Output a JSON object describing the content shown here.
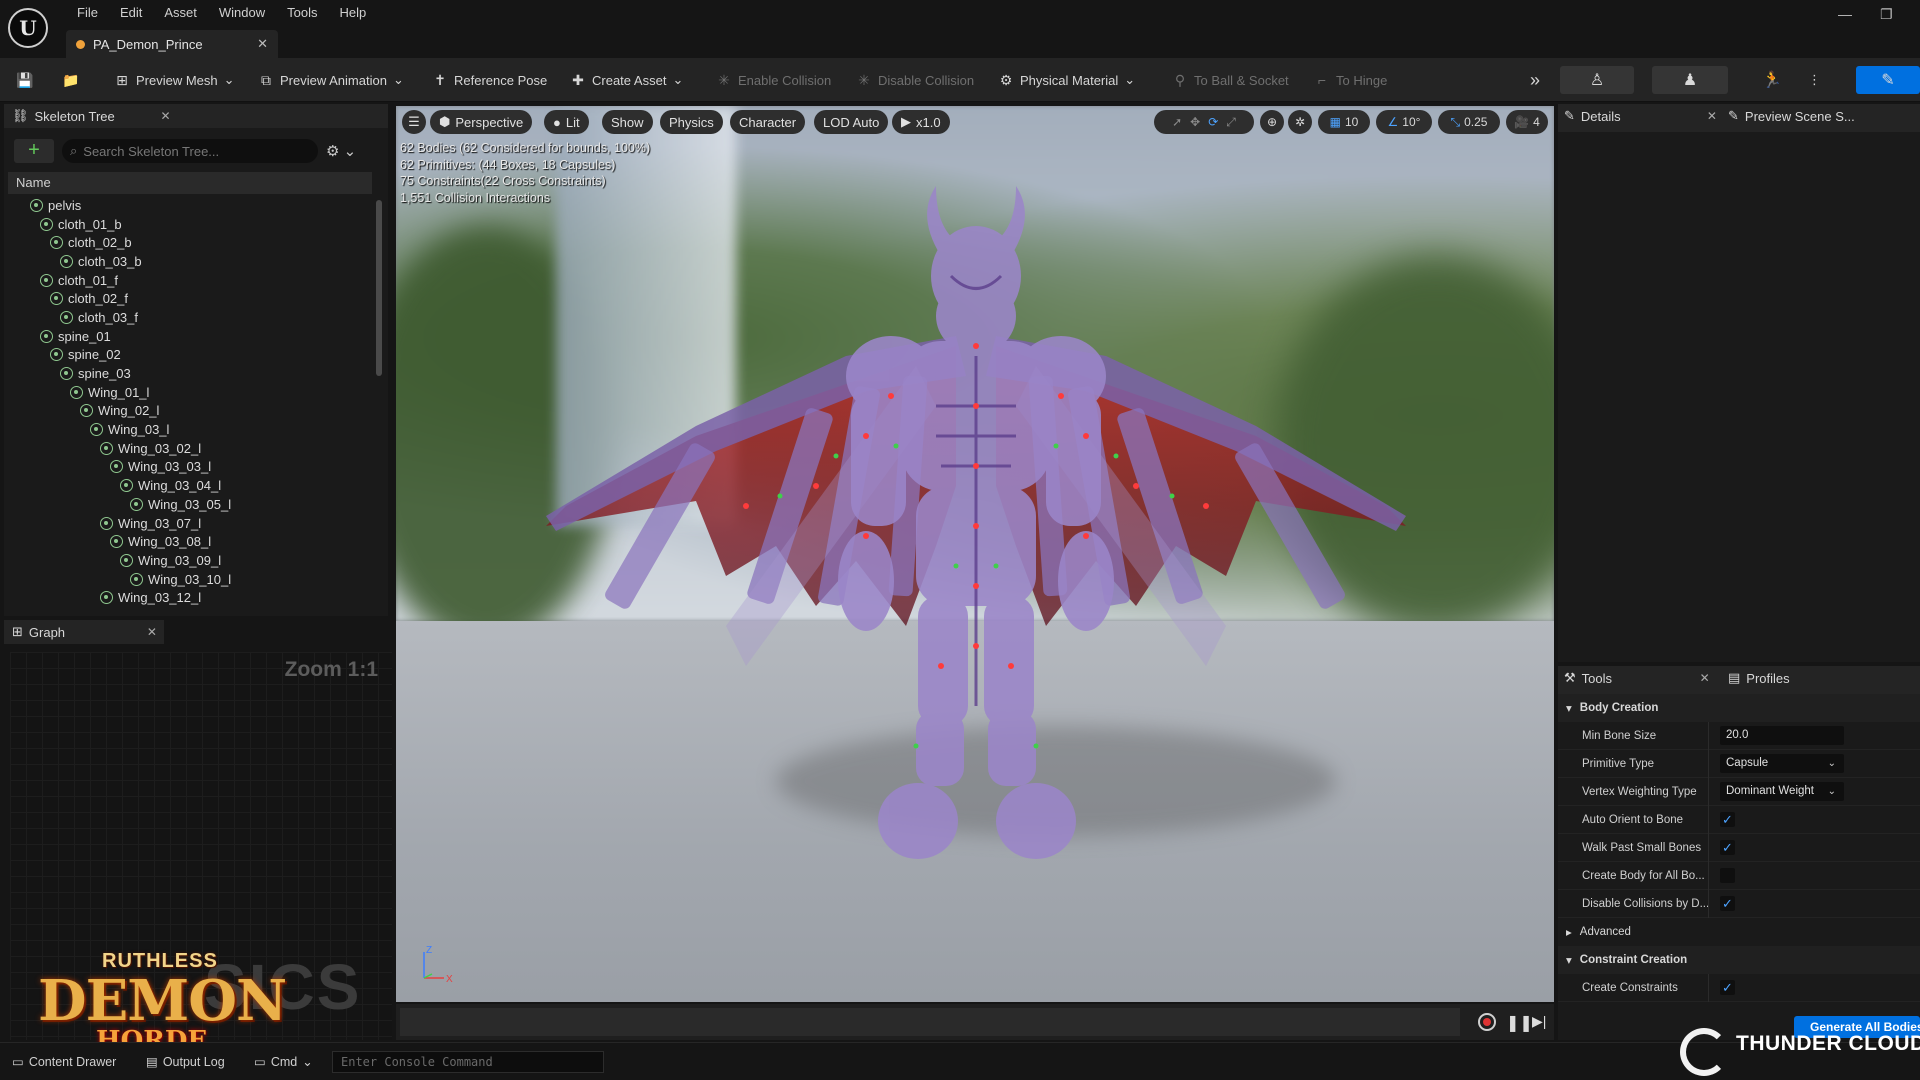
{
  "app": {
    "menu": [
      "File",
      "Edit",
      "Asset",
      "Window",
      "Tools",
      "Help"
    ],
    "tab_title": "PA_Demon_Prince"
  },
  "toolbar": {
    "preview_mesh": "Preview Mesh",
    "preview_animation": "Preview Animation",
    "reference_pose": "Reference Pose",
    "create_asset": "Create Asset",
    "enable_collision": "Enable Collision",
    "disable_collision": "Disable Collision",
    "physical_material": "Physical Material",
    "to_ball_socket": "To Ball & Socket",
    "to_hinge": "To Hinge"
  },
  "skeleton_tree": {
    "title": "Skeleton Tree",
    "search_placeholder": "Search Skeleton Tree...",
    "column_name": "Name",
    "bones": [
      {
        "name": "pelvis",
        "depth": 1
      },
      {
        "name": "cloth_01_b",
        "depth": 2
      },
      {
        "name": "cloth_02_b",
        "depth": 3
      },
      {
        "name": "cloth_03_b",
        "depth": 4
      },
      {
        "name": "cloth_01_f",
        "depth": 2
      },
      {
        "name": "cloth_02_f",
        "depth": 3
      },
      {
        "name": "cloth_03_f",
        "depth": 4
      },
      {
        "name": "spine_01",
        "depth": 2
      },
      {
        "name": "spine_02",
        "depth": 3
      },
      {
        "name": "spine_03",
        "depth": 4
      },
      {
        "name": "Wing_01_l",
        "depth": 5
      },
      {
        "name": "Wing_02_l",
        "depth": 6
      },
      {
        "name": "Wing_03_l",
        "depth": 7
      },
      {
        "name": "Wing_03_02_l",
        "depth": 8
      },
      {
        "name": "Wing_03_03_l",
        "depth": 9
      },
      {
        "name": "Wing_03_04_l",
        "depth": 10
      },
      {
        "name": "Wing_03_05_l",
        "depth": 11
      },
      {
        "name": "Wing_03_07_l",
        "depth": 8
      },
      {
        "name": "Wing_03_08_l",
        "depth": 9
      },
      {
        "name": "Wing_03_09_l",
        "depth": 10
      },
      {
        "name": "Wing_03_10_l",
        "depth": 11
      },
      {
        "name": "Wing_03_12_l",
        "depth": 8
      }
    ]
  },
  "graph": {
    "title": "Graph",
    "zoom": "Zoom 1:1",
    "watermark": "SICS"
  },
  "demon_logo": {
    "line1": "RUTHLESS",
    "line2": "DEMON",
    "line3": "HORDE"
  },
  "viewport": {
    "perspective": "Perspective",
    "lit": "Lit",
    "show": "Show",
    "physics": "Physics",
    "character": "Character",
    "lod": "LOD Auto",
    "speed": "x1.0",
    "grid_snap": "10",
    "rot_snap": "10°",
    "scale_snap": "0.25",
    "camera_speed": "4",
    "stats": [
      "62 Bodies (62 Considered for bounds, 100%)",
      "62 Primitives: (44 Boxes, 18 Capsules)",
      "75 Constraints(22 Cross Constraints)",
      "1,551 Collision Interactions"
    ],
    "axis_z": "Z",
    "axis_x": "X"
  },
  "details": {
    "title": "Details",
    "preview_scene": "Preview Scene S..."
  },
  "tools": {
    "title": "Tools",
    "profiles": "Profiles",
    "body_creation": "Body Creation",
    "min_bone_size_label": "Min Bone Size",
    "min_bone_size": "20.0",
    "primitive_type_label": "Primitive Type",
    "primitive_type": "Capsule",
    "vertex_weighting_label": "Vertex Weighting Type",
    "vertex_weighting": "Dominant Weight",
    "auto_orient_label": "Auto Orient to Bone",
    "walk_past_label": "Walk Past Small Bones",
    "create_body_label": "Create Body for All Bo...",
    "disable_collisions_label": "Disable Collisions by D...",
    "advanced": "Advanced",
    "constraint_creation": "Constraint Creation",
    "create_constraints_label": "Create Constraints",
    "generate_button": "Generate All Bodies"
  },
  "status_bar": {
    "content_drawer": "Content Drawer",
    "output_log": "Output Log",
    "cmd": "Cmd",
    "console_placeholder": "Enter Console Command"
  },
  "thunder_cloud": {
    "brand": "THUNDER CLOUD"
  },
  "colors": {
    "accent": "#0070e0",
    "bone_icon": "#8fc78f",
    "checkbox": "#4da3ff"
  }
}
